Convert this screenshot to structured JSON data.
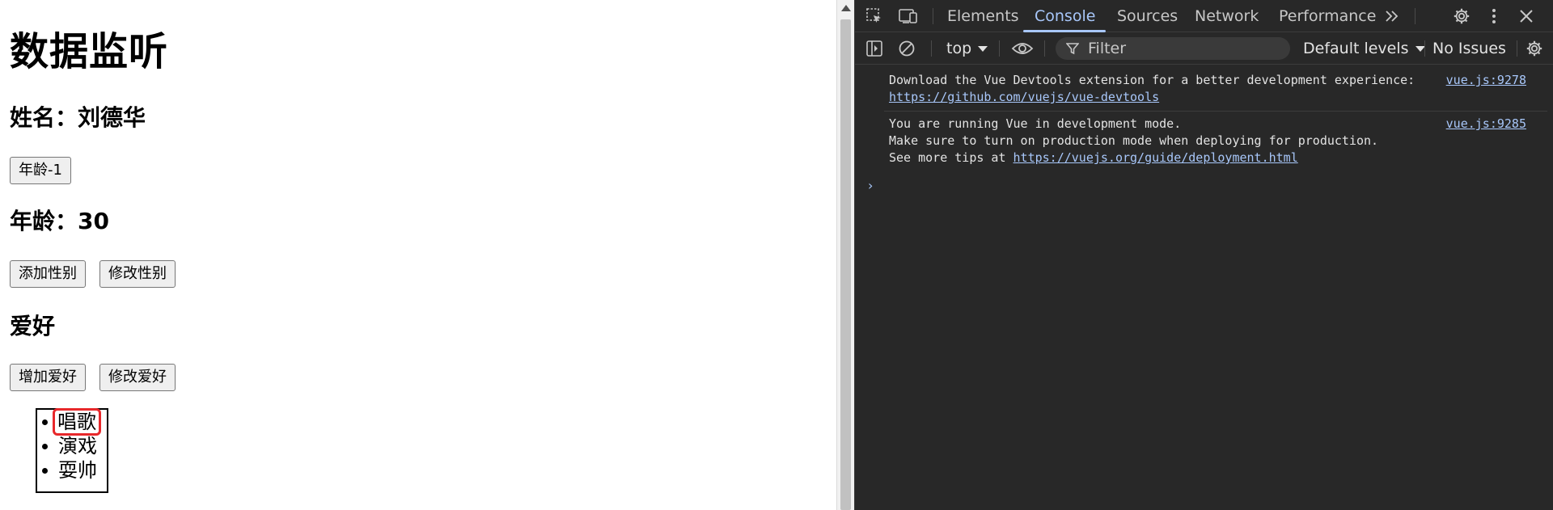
{
  "page": {
    "title": "数据监听",
    "name_line": "姓名：刘德华",
    "age_decrement_button": "年龄-1",
    "age_line": "年龄：30",
    "add_gender_button": "添加性别",
    "modify_gender_button": "修改性别",
    "hobby_heading": "爱好",
    "add_hobby_button": "增加爱好",
    "modify_hobby_button": "修改爱好",
    "hobbies": [
      "唱歌",
      "演戏",
      "耍帅"
    ]
  },
  "devtools": {
    "tabs": [
      "Elements",
      "Console",
      "Sources",
      "Network",
      "Performance"
    ],
    "active_tab": "Console",
    "more_tabs_icon": "chevron-double-right-icon",
    "toolbar": {
      "context": "top",
      "filter_placeholder": "Filter",
      "levels": "Default levels",
      "issues": "No Issues"
    },
    "messages": [
      {
        "line1": "Download the Vue Devtools extension for a better development experience:",
        "link": "https://github.com/vuejs/vue-devtools",
        "source": "vue.js:9278"
      },
      {
        "line1": "You are running Vue in development mode.",
        "line2": "Make sure to turn on production mode when deploying for production.",
        "line3_prefix": "See more tips at ",
        "link": "https://vuejs.org/guide/deployment.html",
        "source": "vue.js:9285"
      }
    ],
    "prompt": "›"
  },
  "colors": {
    "devtools_bg": "#282828",
    "accent": "#a8c7fa",
    "highlight": "#e8282b"
  }
}
